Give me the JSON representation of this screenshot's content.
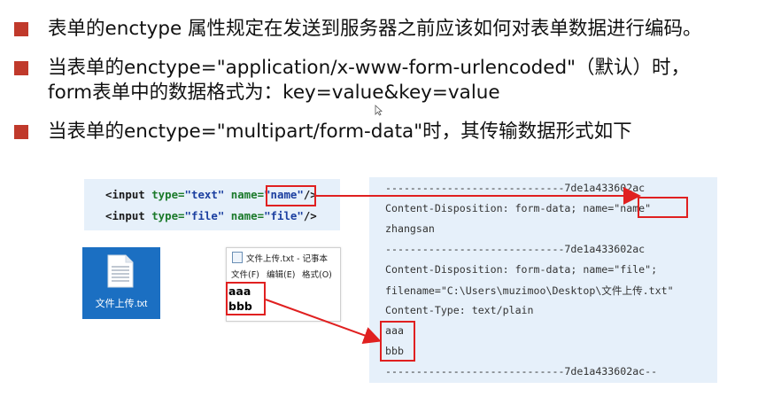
{
  "bullets": [
    {
      "text": "表单的enctype 属性规定在发送到服务器之前应该如何对表单数据进行编码。"
    },
    {
      "line1": "当表单的enctype=\"application/x-www-form-urlencoded\"（默认）时，",
      "line2": "form表单中的数据格式为：key=value&key=value"
    },
    {
      "text": "当表单的enctype=\"multipart/form-data\"时，其传输数据形式如下"
    }
  ],
  "html_code": [
    {
      "open": "<input ",
      "type_attr": "type=",
      "type_val": "\"text\"",
      "name_attr": " name=",
      "name_val": "\"name\"",
      "close": "/>"
    },
    {
      "open": "<input ",
      "type_attr": "type=",
      "type_val": "\"file\"",
      "name_attr": " name=",
      "name_val": "\"file\"",
      "close": "/>"
    }
  ],
  "file_icon": {
    "label": "文件上传.txt",
    "icon": "text-file-icon"
  },
  "notepad": {
    "title": "文件上传.txt - 记事本",
    "menu": [
      "文件(F)",
      "编辑(E)",
      "格式(O)"
    ],
    "content": [
      "aaa",
      "bbb"
    ]
  },
  "request_body": {
    "boundary1": "-----------------------------7de1a433602ac",
    "disposition1_prefix": "Content-Disposition: form-data; name=",
    "disposition1_name": "\"name\"",
    "value1": "zhangsan",
    "boundary2": "-----------------------------7de1a433602ac",
    "disposition2": "Content-Disposition:  form-data;  name=\"file\";",
    "filename": "filename=\"C:\\Users\\muzimoo\\Desktop\\文件上传.txt\"",
    "content_type": "Content-Type: text/plain",
    "file_lines": [
      "aaa",
      "bbb"
    ],
    "boundary_end": "-----------------------------7de1a433602ac--"
  },
  "colors": {
    "bullet": "#c0392b",
    "highlight": "#e02020",
    "code_bg": "#e6f0fa",
    "icon_bg": "#1b6fc2"
  }
}
